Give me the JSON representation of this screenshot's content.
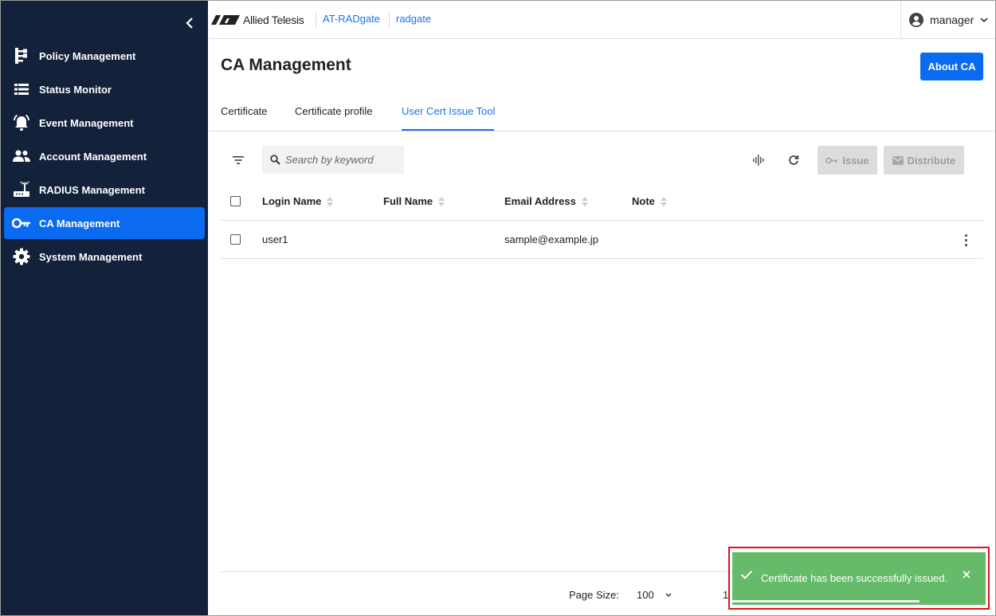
{
  "sidebar": {
    "collapse_icon": "chevron-left-icon",
    "items": [
      {
        "label": "Policy Management",
        "icon": "policy-tree-icon",
        "active": false
      },
      {
        "label": "Status Monitor",
        "icon": "list-icon",
        "active": false
      },
      {
        "label": "Event Management",
        "icon": "alarm-icon",
        "active": false
      },
      {
        "label": "Account Management",
        "icon": "people-icon",
        "active": false
      },
      {
        "label": "RADIUS Management",
        "icon": "router-icon",
        "active": false
      },
      {
        "label": "CA Management",
        "icon": "key-icon",
        "active": true
      },
      {
        "label": "System Management",
        "icon": "gear-icon",
        "active": false
      }
    ]
  },
  "header": {
    "logo_text": "Allied Telesis",
    "product": "AT-RADgate",
    "host": "radgate",
    "user": "manager"
  },
  "page": {
    "title": "CA Management",
    "about_button": "About CA"
  },
  "tabs": [
    {
      "label": "Certificate",
      "active": false
    },
    {
      "label": "Certificate profile",
      "active": false
    },
    {
      "label": "User Cert Issue Tool",
      "active": true
    }
  ],
  "toolbar": {
    "search_placeholder": "Search by keyword",
    "issue_label": "Issue",
    "distribute_label": "Distribute"
  },
  "table": {
    "columns": [
      "Login Name",
      "Full Name",
      "Email Address",
      "Note"
    ],
    "rows": [
      {
        "login": "user1",
        "full_name": "",
        "email": "sample@example.jp",
        "note": ""
      }
    ]
  },
  "footer": {
    "page_size_label": "Page Size:",
    "page_size_value": "100",
    "page_number": "1"
  },
  "toast": {
    "message": "Certificate has been successfully issued.",
    "progress_fraction": 0.74
  },
  "colors": {
    "sidebar_bg": "#13213b",
    "accent": "#0a6bf0",
    "link": "#1a73e8",
    "toast_bg": "#66bb6a",
    "highlight_border": "#e0141e"
  }
}
